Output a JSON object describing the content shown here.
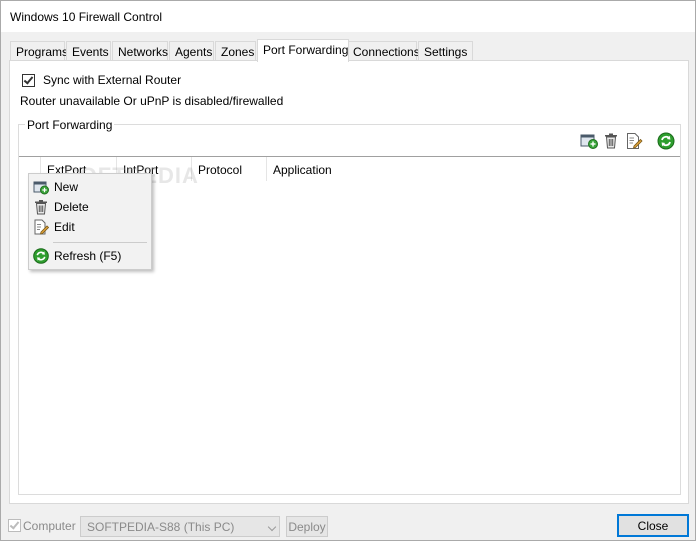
{
  "window": {
    "title": "Windows 10 Firewall Control"
  },
  "tabs": [
    {
      "label": "Programs"
    },
    {
      "label": "Events"
    },
    {
      "label": "Networks"
    },
    {
      "label": "Agents"
    },
    {
      "label": "Zones"
    },
    {
      "label": "Port Forwarding",
      "active": true
    },
    {
      "label": "Connections"
    },
    {
      "label": "Settings"
    }
  ],
  "port_forwarding": {
    "sync_label": "Sync with External Router",
    "sync_checked": true,
    "status_text": "Router unavailable Or uPnP is disabled/firewalled",
    "group_title": "Port Forwarding",
    "toolbar_icons": [
      "add-icon",
      "delete-icon",
      "edit-icon",
      "refresh-icon"
    ],
    "columns": [
      "ExtPort",
      "IntPort",
      "Protocol",
      "Application"
    ],
    "rows": []
  },
  "context_menu": {
    "items": [
      {
        "label": "New",
        "icon": "new-icon"
      },
      {
        "label": "Delete",
        "icon": "delete-icon"
      },
      {
        "label": "Edit",
        "icon": "edit-icon"
      },
      {
        "label": "Refresh (F5)",
        "icon": "refresh-icon"
      }
    ]
  },
  "footer": {
    "computer_label": "Computer",
    "computer_checked": true,
    "computer_select_value": "SOFTPEDIA-S88 (This PC)",
    "deploy_label": "Deploy",
    "close_label": "Close"
  },
  "watermark": "SOFTPEDIA",
  "colors": {
    "accent": "#0078d7",
    "refresh_green": "#2e9e2e"
  }
}
